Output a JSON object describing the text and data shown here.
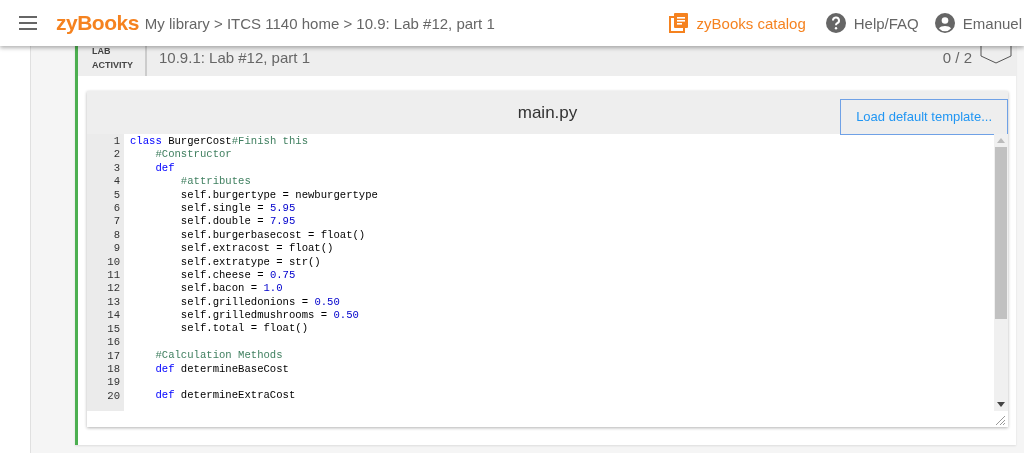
{
  "header": {
    "logo": "zyBooks",
    "breadcrumb": "My library > ITCS 1140 home > 10.9: Lab #12, part 1",
    "catalog_link": "zyBooks catalog",
    "help_link": "Help/FAQ",
    "user_name": "Emanuel"
  },
  "activity": {
    "label_lines": [
      "LAB",
      "ACTIVITY"
    ],
    "title": "10.9.1: Lab #12, part 1",
    "score": "0 / 2"
  },
  "editor": {
    "filename": "main.py",
    "button": "Load default template...",
    "lines": [
      {
        "number": "1",
        "segments": [
          {
            "kind": "keyword",
            "text": "class"
          },
          {
            "kind": "plain",
            "text": " BurgerCost"
          },
          {
            "kind": "comment",
            "text": "#Finish this"
          }
        ]
      },
      {
        "number": "2",
        "segments": [
          {
            "kind": "comment",
            "text": "    #Constructor"
          }
        ]
      },
      {
        "number": "3",
        "segments": [
          {
            "kind": "keyword",
            "text": "    def"
          }
        ]
      },
      {
        "number": "4",
        "segments": [
          {
            "kind": "comment",
            "text": "        #attributes"
          }
        ]
      },
      {
        "number": "5",
        "segments": [
          {
            "kind": "plain",
            "text": "        self.burgertype = newburgertype"
          }
        ]
      },
      {
        "number": "6",
        "segments": [
          {
            "kind": "plain",
            "text": "        self.single = "
          },
          {
            "kind": "number",
            "text": "5.95"
          }
        ]
      },
      {
        "number": "7",
        "segments": [
          {
            "kind": "plain",
            "text": "        self.double = "
          },
          {
            "kind": "number",
            "text": "7.95"
          }
        ]
      },
      {
        "number": "8",
        "segments": [
          {
            "kind": "plain",
            "text": "        self.burgerbasecost = float()"
          }
        ]
      },
      {
        "number": "9",
        "segments": [
          {
            "kind": "plain",
            "text": "        self.extracost = float()"
          }
        ]
      },
      {
        "number": "10",
        "segments": [
          {
            "kind": "plain",
            "text": "        self.extratype = str()"
          }
        ]
      },
      {
        "number": "11",
        "segments": [
          {
            "kind": "plain",
            "text": "        self.cheese = "
          },
          {
            "kind": "number",
            "text": "0.75"
          }
        ]
      },
      {
        "number": "12",
        "segments": [
          {
            "kind": "plain",
            "text": "        self.bacon = "
          },
          {
            "kind": "number",
            "text": "1.0"
          }
        ]
      },
      {
        "number": "13",
        "segments": [
          {
            "kind": "plain",
            "text": "        self.grilledonions = "
          },
          {
            "kind": "number",
            "text": "0.50"
          }
        ]
      },
      {
        "number": "14",
        "segments": [
          {
            "kind": "plain",
            "text": "        self.grilledmushrooms = "
          },
          {
            "kind": "number",
            "text": "0.50"
          }
        ]
      },
      {
        "number": "15",
        "segments": [
          {
            "kind": "plain",
            "text": "        self.total = float()"
          }
        ]
      },
      {
        "number": "16"
      },
      {
        "number": "17",
        "segments": [
          {
            "kind": "comment",
            "text": "    #Calculation Methods"
          }
        ]
      },
      {
        "number": "18",
        "segments": [
          {
            "kind": "keyword",
            "text": "    def"
          },
          {
            "kind": "plain",
            "text": " determineBaseCost"
          }
        ]
      },
      {
        "number": "19"
      },
      {
        "number": "20",
        "segments": [
          {
            "kind": "keyword",
            "text": "    def"
          },
          {
            "kind": "plain",
            "text": " determineExtraCost"
          }
        ]
      }
    ]
  }
}
